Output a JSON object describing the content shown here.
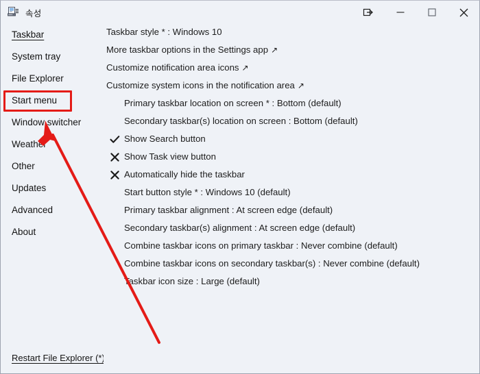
{
  "window": {
    "title": "속성",
    "app_icon": "taskbar-window-icon"
  },
  "titlebar": {
    "buttons": [
      {
        "name": "restore-down-icon",
        "label": ""
      },
      {
        "name": "minimize-icon",
        "label": ""
      },
      {
        "name": "maximize-icon",
        "label": ""
      },
      {
        "name": "close-icon",
        "label": ""
      }
    ]
  },
  "sidebar": {
    "items": [
      {
        "label": "Taskbar",
        "active": true
      },
      {
        "label": "System tray",
        "active": false
      },
      {
        "label": "File Explorer",
        "active": false
      },
      {
        "label": "Start menu",
        "active": false
      },
      {
        "label": "Window switcher",
        "active": false
      },
      {
        "label": "Weather",
        "active": false
      },
      {
        "label": "Other",
        "active": false
      },
      {
        "label": "Updates",
        "active": false
      },
      {
        "label": "Advanced",
        "active": false
      },
      {
        "label": "About",
        "active": false
      }
    ],
    "footer_link": "Restart File Explorer (*)"
  },
  "content": {
    "rows": [
      {
        "label": "Taskbar style * : Windows 10",
        "indent": 0,
        "mark": "none",
        "external": false
      },
      {
        "label": "More taskbar options in the Settings app",
        "indent": 0,
        "mark": "none",
        "external": true
      },
      {
        "label": "Customize notification area icons",
        "indent": 0,
        "mark": "none",
        "external": true
      },
      {
        "label": "Customize system icons in the notification area",
        "indent": 0,
        "mark": "none",
        "external": true
      },
      {
        "label": "Primary taskbar location on screen * : Bottom (default)",
        "indent": 1,
        "mark": "none",
        "external": false
      },
      {
        "label": "Secondary taskbar(s) location on screen : Bottom (default)",
        "indent": 1,
        "mark": "none",
        "external": false
      },
      {
        "label": "Show Search button",
        "indent": 1,
        "mark": "check",
        "external": false
      },
      {
        "label": "Show Task view button",
        "indent": 1,
        "mark": "cross",
        "external": false
      },
      {
        "label": "Automatically hide the taskbar",
        "indent": 1,
        "mark": "cross",
        "external": false
      },
      {
        "label": "Start button style * : Windows 10 (default)",
        "indent": 1,
        "mark": "none",
        "external": false
      },
      {
        "label": "Primary taskbar alignment : At screen edge (default)",
        "indent": 1,
        "mark": "none",
        "external": false
      },
      {
        "label": "Secondary taskbar(s) alignment : At screen edge (default)",
        "indent": 1,
        "mark": "none",
        "external": false
      },
      {
        "label": "Combine taskbar icons on primary taskbar : Never combine (default)",
        "indent": 1,
        "mark": "none",
        "external": false
      },
      {
        "label": "Combine taskbar icons on secondary taskbar(s) : Never combine (default)",
        "indent": 1,
        "mark": "none",
        "external": false
      },
      {
        "label": "Taskbar icon size : Large (default)",
        "indent": 1,
        "mark": "none",
        "external": false
      }
    ],
    "external_arrow_glyph": "↗"
  },
  "annotation": {
    "color": "#e41b17",
    "highlight_target": "Start menu",
    "arrow_points_to": "Start menu"
  }
}
